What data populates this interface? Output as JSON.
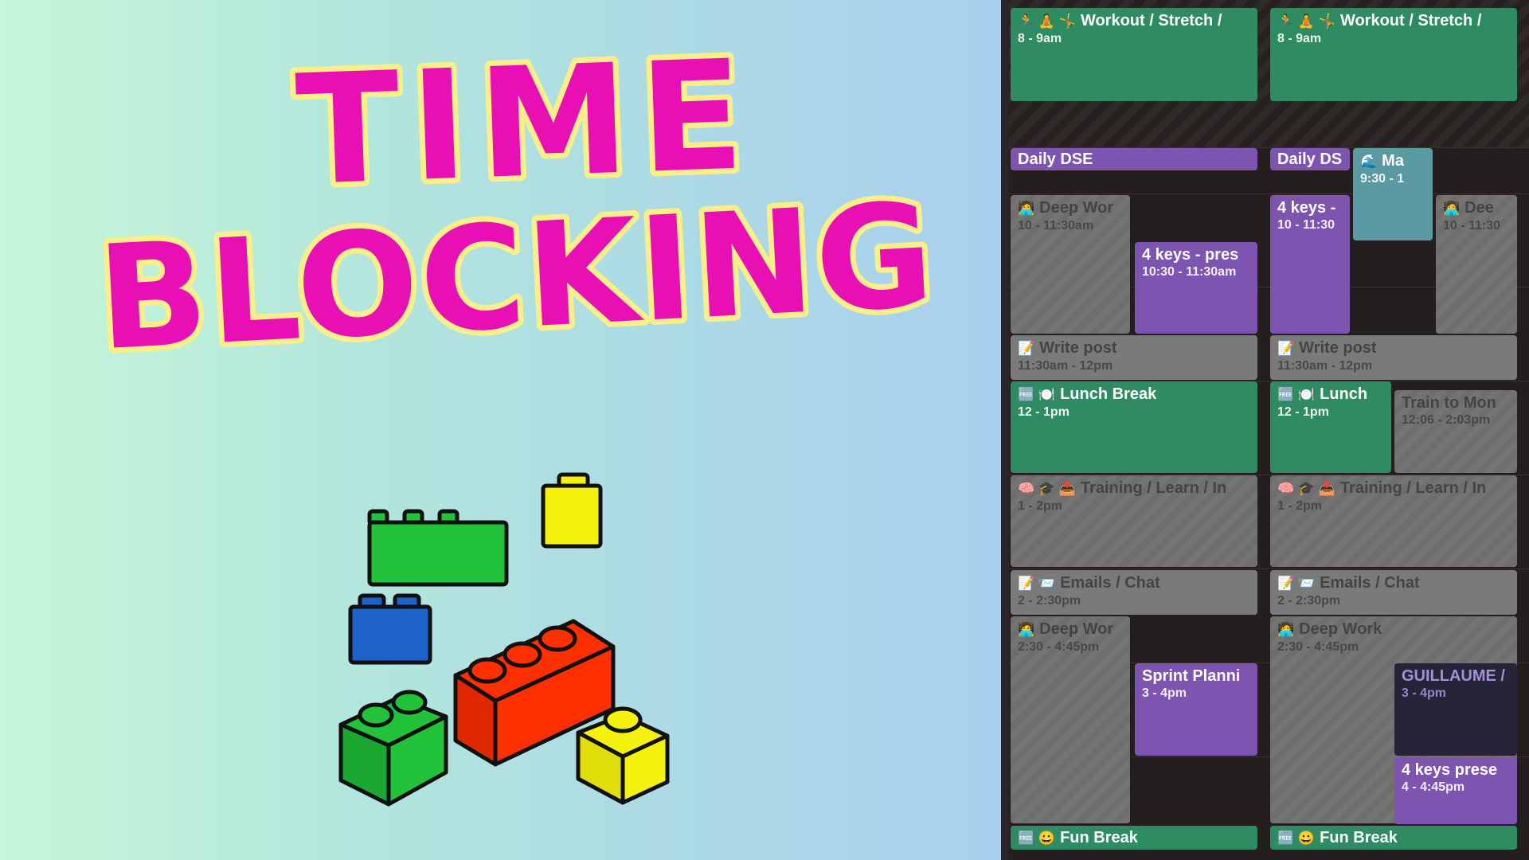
{
  "title": {
    "line1": "TIME",
    "line2": "BLOCKING",
    "fill": "#e80fb5",
    "outline": "#f6ef8a"
  },
  "brick_colors": {
    "green": "#22c23a",
    "yellow": "#f4f20c",
    "blue": "#1e63c9",
    "red": "#ff3000"
  },
  "calendar": {
    "col1": {
      "workout": {
        "icons": "🏃 🧘 🤸",
        "title": "Workout / Stretch /",
        "time": "8 - 9am"
      },
      "dse": {
        "title": "Daily DSE"
      },
      "deep1": {
        "icons": "🧑‍💻",
        "title": "Deep Wor",
        "time": "10 - 11:30am"
      },
      "keys": {
        "title": "4 keys - pres",
        "time": "10:30 - 11:30am"
      },
      "write": {
        "icons": "📝",
        "title": "Write post",
        "time": "11:30am - 12pm"
      },
      "lunch": {
        "icons": "🆓 🍽️",
        "title": "Lunch Break",
        "time": "12 - 1pm"
      },
      "training": {
        "icons": "🧠 🎓 📥",
        "title": "Training / Learn / In",
        "time": "1 - 2pm"
      },
      "emails": {
        "icons": "📝 📨",
        "title": "Emails / Chat",
        "time": "2 - 2:30pm"
      },
      "deep2": {
        "icons": "🧑‍💻",
        "title": "Deep Wor",
        "time": "2:30 - 4:45pm"
      },
      "sprint": {
        "title": "Sprint Planni",
        "time": "3 - 4pm"
      },
      "fun": {
        "icons": "🆓 😀",
        "title": "Fun Break"
      }
    },
    "col2": {
      "workout": {
        "icons": "🏃 🧘 🤸",
        "title": "Workout / Stretch /",
        "time": "8 - 9am"
      },
      "dse": {
        "title": "Daily DS"
      },
      "ma": {
        "icons": "🌊",
        "title": "Ma",
        "time": "9:30 - 1"
      },
      "keys": {
        "title": "4 keys -",
        "time": "10 - 11:30"
      },
      "deep1": {
        "icons": "🧑‍💻",
        "title": "Dee",
        "time": "10 - 11:30"
      },
      "write": {
        "icons": "📝",
        "title": "Write post",
        "time": "11:30am - 12pm"
      },
      "lunch": {
        "icons": "🆓 🍽️",
        "title": "Lunch",
        "time": "12 - 1pm"
      },
      "train_mon": {
        "title": "Train to Mon",
        "time": "12:06 - 2:03pm"
      },
      "training": {
        "icons": "🧠 🎓 📥",
        "title": "Training / Learn / In",
        "time": "1 - 2pm"
      },
      "emails": {
        "icons": "📝 📨",
        "title": "Emails / Chat",
        "time": "2 - 2:30pm"
      },
      "deep2": {
        "icons": "🧑‍💻",
        "title": "Deep Work",
        "time": "2:30 - 4:45pm"
      },
      "guillaume": {
        "title": "GUILLAUME /",
        "time": "3 - 4pm"
      },
      "keys2": {
        "title": "4 keys prese",
        "time": "4 - 4:45pm"
      },
      "fun": {
        "icons": "🆓 😀",
        "title": "Fun Break"
      }
    }
  }
}
